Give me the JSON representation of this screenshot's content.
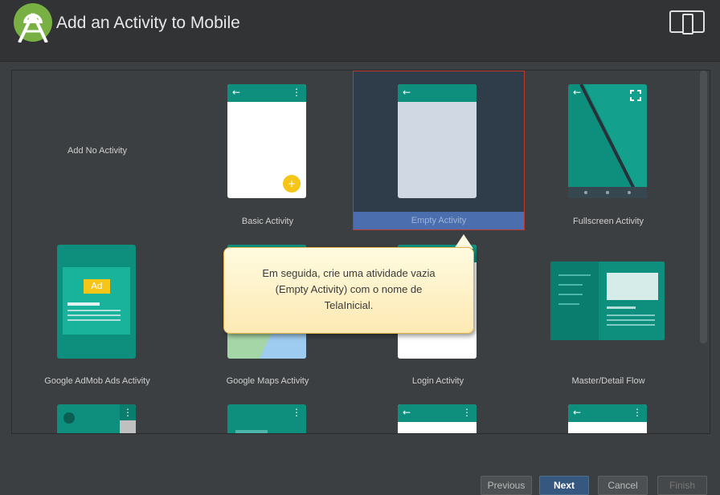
{
  "header": {
    "title": "Add an Activity to Mobile",
    "logo_icon": "android-studio-logo-icon",
    "device_icon": "mobile-device-icon"
  },
  "activities": [
    {
      "label": "Add No Activity"
    },
    {
      "label": "Basic Activity"
    },
    {
      "label": "Empty Activity",
      "selected": true
    },
    {
      "label": "Fullscreen Activity"
    },
    {
      "label": "Google AdMob Ads Activity",
      "ad_badge": "Ad"
    },
    {
      "label": "Google Maps Activity"
    },
    {
      "label": "Login Activity"
    },
    {
      "label": "Master/Detail Flow"
    }
  ],
  "tooltip": {
    "line1": "Em seguida, crie uma atividade vazia",
    "line2": "(Empty Activity) com o nome de",
    "line3": "TelaInicial."
  },
  "footer": {
    "previous": "Previous",
    "next": "Next",
    "cancel": "Cancel",
    "finish": "Finish"
  },
  "colors": {
    "accent_teal": "#0e8f7e",
    "selection_blue": "#4b6eaf",
    "selection_border": "#c0392b",
    "fab_yellow": "#f5c518"
  }
}
